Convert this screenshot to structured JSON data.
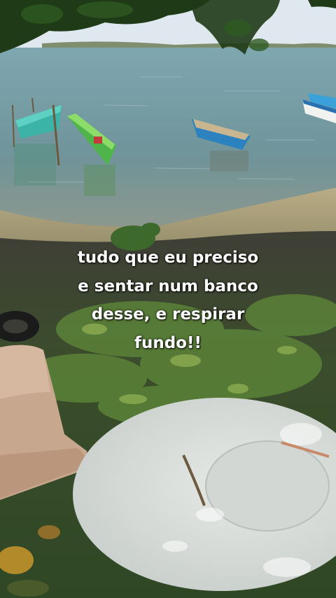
{
  "caption": {
    "lines": [
      "tudo que eu preciso",
      "e sentar num banco",
      "desse, e respirar",
      "fundo!!"
    ]
  },
  "scene": {
    "subjects": [
      "river",
      "wooden-boats",
      "shoreline",
      "plastic-chair",
      "round-table",
      "tree-branches",
      "tire"
    ],
    "colors": {
      "sky": "#dfe8ee",
      "water": "#6f9aa3",
      "sand": "#b7ab82",
      "grass": "#3c5a2a",
      "table": "#d9dedb",
      "chair": "#c9a58a",
      "boat_green": "#49b04a",
      "boat_blue": "#2a8fc7"
    }
  }
}
